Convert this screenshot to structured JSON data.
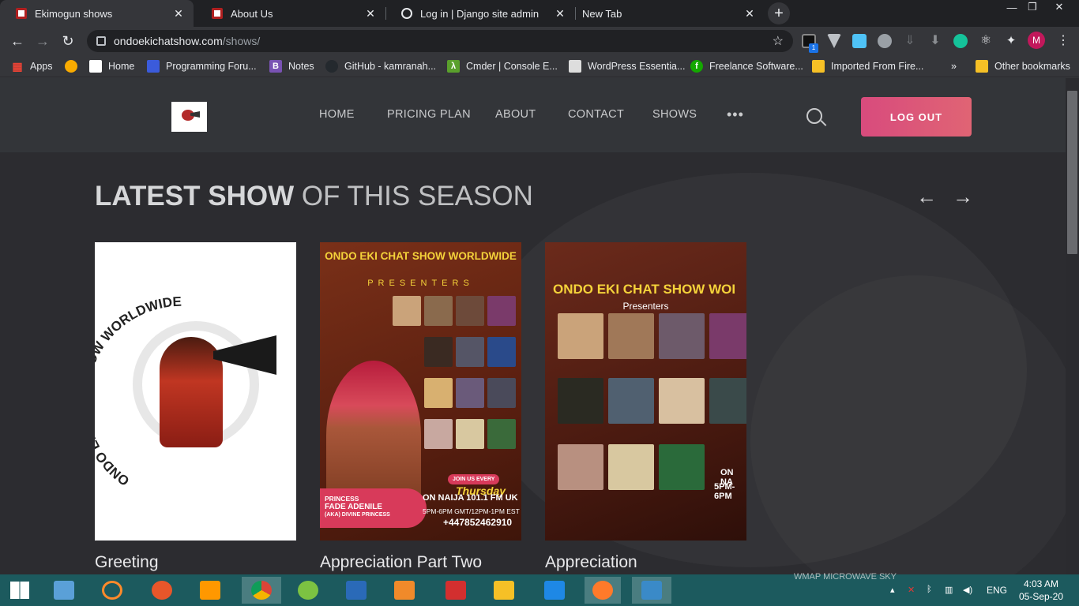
{
  "browser": {
    "tabs": [
      {
        "title": "Ekimogun shows",
        "active": true
      },
      {
        "title": "About Us",
        "active": false
      },
      {
        "title": "Log in | Django site admin",
        "active": false
      },
      {
        "title": "New Tab",
        "active": false
      }
    ],
    "address": {
      "domain": "ondoekichatshow.com",
      "path": "/shows/"
    },
    "profile_initial": "M",
    "extension_badge": "1",
    "bookmarks": [
      "Apps",
      "Home",
      "Programming Foru...",
      "Notes",
      "GitHub - kamranah...",
      "Cmder | Console E...",
      "WordPress Essentia...",
      "Freelance Software...",
      "Imported From Fire...",
      "Other bookmarks"
    ],
    "bookmark_overflow": "»"
  },
  "site": {
    "nav": [
      "HOME",
      "PRICING PLAN",
      "ABOUT",
      "CONTACT",
      "SHOWS"
    ],
    "more": "•••",
    "logout": "LOG OUT",
    "section_title_bold": "LATEST SHOW",
    "section_title_rest": " OF THIS SEASON",
    "prev": "←",
    "next": "→",
    "shows": [
      {
        "caption": "Greeting"
      },
      {
        "caption": "Appreciation Part Two"
      },
      {
        "caption": "Appreciation"
      }
    ],
    "poster_texts": {
      "logo_ring": "ONDO EKI CHAT SHOW WORLDWIDE",
      "poster2_head": "ONDO EKI CHAT SHOW WORLDWIDE",
      "poster2_presenters": "PRESENTERS",
      "poster2_princess": "PRINCESS",
      "poster2_name": "FADE ADENILE",
      "poster2_aka": "(AKA) DIVINE PRINCESS",
      "poster2_join": "JOIN US EVERY",
      "poster2_day": "Thursday",
      "poster2_radio": "ON NAIJA 101.1 FM UK",
      "poster2_time": "5PM-6PM GMT/12PM-1PM EST",
      "poster2_number": "+447852462910",
      "poster3_head": "ONDO EKI CHAT SHOW WOI",
      "poster3_presenters": "Presenters",
      "poster3_on": "ON NA",
      "poster3_time": "5PM-6PM"
    }
  },
  "os": {
    "watermark": "WMAP MICROWAVE SKY",
    "lang": "ENG",
    "time": "4:03 AM",
    "date": "05-Sep-20"
  }
}
